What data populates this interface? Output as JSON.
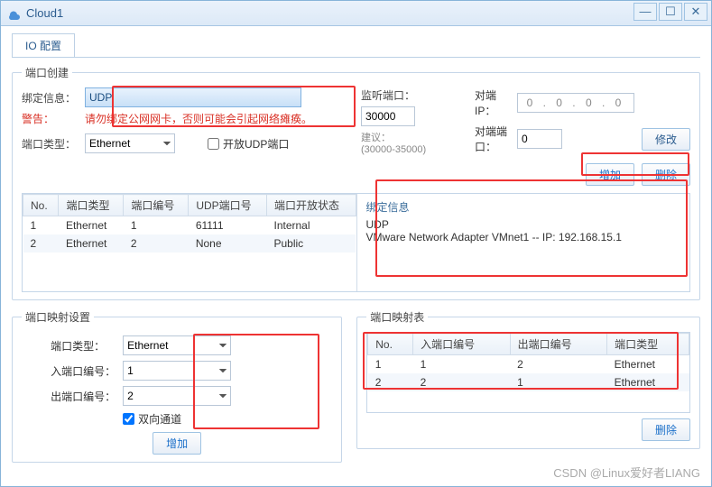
{
  "window": {
    "title": "Cloud1"
  },
  "tab": {
    "label": "IO 配置"
  },
  "port_create": {
    "legend": "端口创建",
    "bind_label": "绑定信息：",
    "bind_value": "UDP",
    "warn_label": "警告：",
    "warn_text": "请勿绑定公网网卡，否则可能会引起网络瘫痪。",
    "type_label": "端口类型：",
    "type_value": "Ethernet",
    "open_udp_label": "开放UDP端口",
    "listen_label": "监听端口：",
    "listen_value": "30000",
    "suggest_label": "建议：",
    "suggest_range": "(30000-35000)",
    "peer_ip_label": "对端IP：",
    "peer_ip_value": "0 . 0 . 0 . 0",
    "peer_port_label": "对端端口：",
    "peer_port_value": "0",
    "modify_btn": "修改",
    "add_btn": "增加",
    "delete_btn": "删除",
    "table": {
      "headers": [
        "No.",
        "端口类型",
        "端口编号",
        "UDP端口号",
        "端口开放状态"
      ],
      "rows": [
        [
          "1",
          "Ethernet",
          "1",
          "61111",
          "Internal"
        ],
        [
          "2",
          "Ethernet",
          "2",
          "None",
          "Public"
        ]
      ]
    },
    "bind_info": {
      "title": "绑定信息",
      "line1": "UDP",
      "line2": "VMware Network Adapter VMnet1 -- IP: 192.168.15.1"
    }
  },
  "map_set": {
    "legend": "端口映射设置",
    "type_label": "端口类型：",
    "type_value": "Ethernet",
    "in_label": "入端口编号：",
    "in_value": "1",
    "out_label": "出端口编号：",
    "out_value": "2",
    "bidir_label": "双向通道",
    "add_btn": "增加"
  },
  "map_table": {
    "legend": "端口映射表",
    "headers": [
      "No.",
      "入端口编号",
      "出端口编号",
      "端口类型"
    ],
    "rows": [
      [
        "1",
        "1",
        "2",
        "Ethernet"
      ],
      [
        "2",
        "2",
        "1",
        "Ethernet"
      ]
    ],
    "delete_btn": "删除"
  },
  "watermark": "CSDN @Linux爱好者LIANG"
}
